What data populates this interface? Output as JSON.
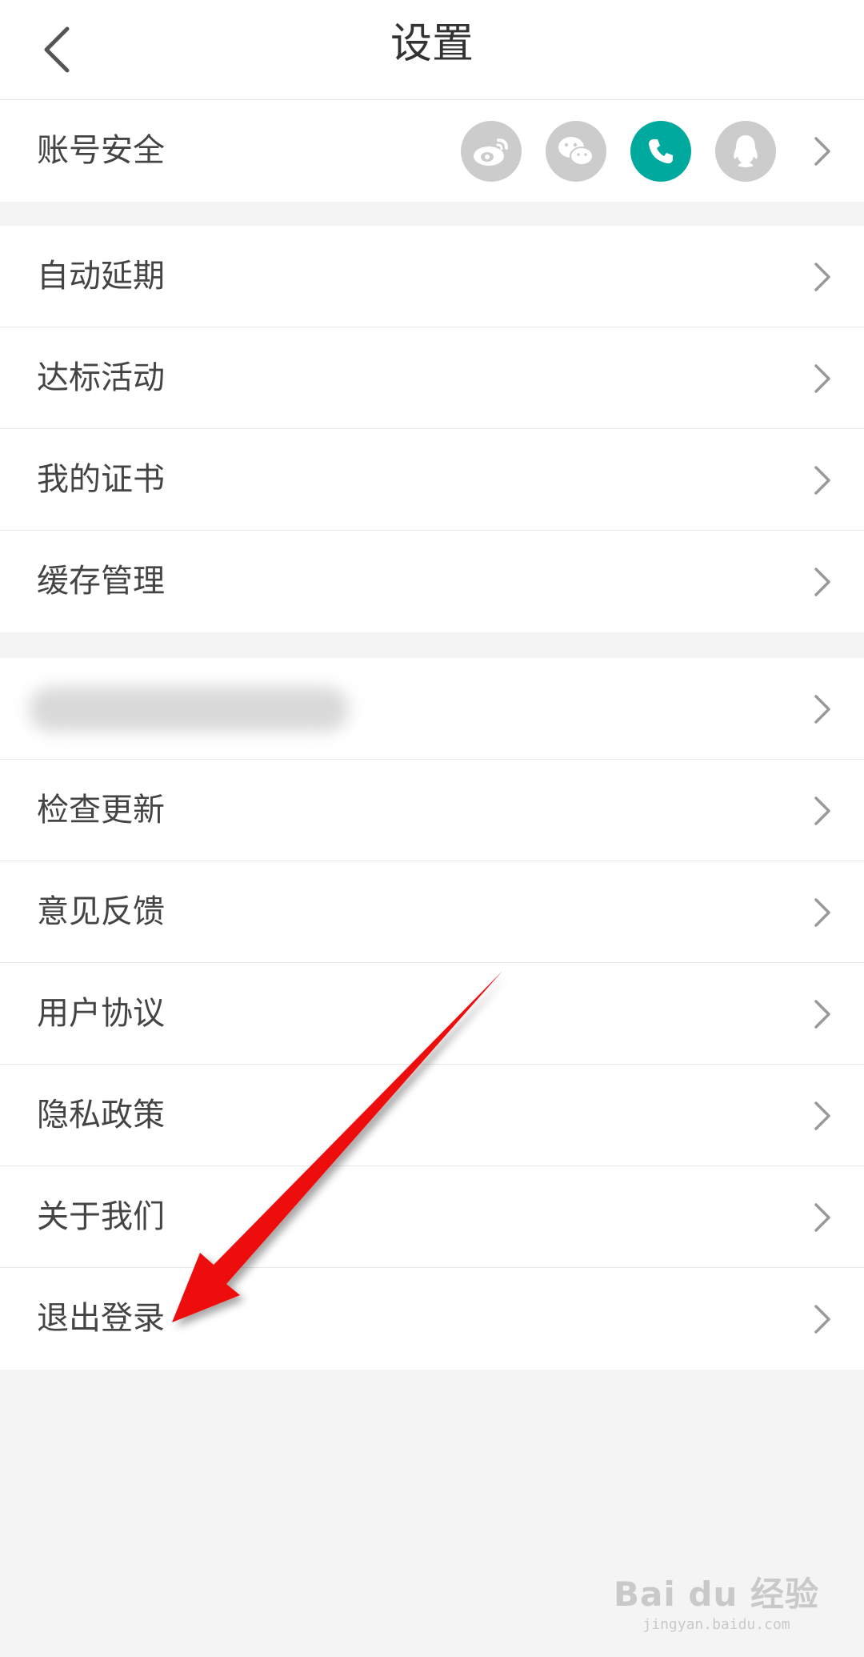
{
  "header": {
    "title": "设置"
  },
  "account": {
    "label": "账号安全",
    "icons": [
      "weibo-icon",
      "wechat-icon",
      "phone-icon",
      "qq-icon"
    ],
    "active_color": "#00a99d",
    "inactive_color": "#cccccc"
  },
  "group1": [
    {
      "label": "自动延期"
    },
    {
      "label": "达标活动"
    },
    {
      "label": "我的证书"
    },
    {
      "label": "缓存管理"
    }
  ],
  "group2": [
    {
      "label": ""
    },
    {
      "label": "检查更新"
    },
    {
      "label": "意见反馈"
    },
    {
      "label": "用户协议"
    },
    {
      "label": "隐私政策"
    },
    {
      "label": "关于我们"
    },
    {
      "label": "退出登录"
    }
  ],
  "annotation": {
    "arrow_color": "#ee1111"
  },
  "watermark": {
    "main": "Bai du 经验",
    "sub": "jingyan.baidu.com"
  }
}
